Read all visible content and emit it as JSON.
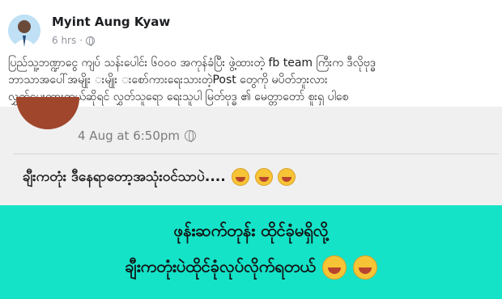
{
  "post": {
    "author": "Myint Aung Kyaw",
    "time": "6 hrs",
    "separator": "·",
    "audience_icon": "globe-icon",
    "caption_lines": [
      "ပြည်သူ့ဘဏ္ဍာငွေ ကျပ် သန်းပေါင်း ၆၀၀၀ အကုန်ခံပြီး ဖွဲ့ထားတဲ့ fb team ကြီးက ဒီလိုဗုဒ္ဓ",
      "ဘာသာအပေါ်အမျိုး းမျိုး းစော်ကားရေးသားတဲ့Post တွေကို မပိတ်ဘူးလား",
      "လွှတ်ပေးထားတယ်ဆိုရင် လွှတ်သူရော ရေးသူပါ မြတ်ဗုဒ္ဓ ၏ မေတ္တာတော် စူးရှ ပါစေ"
    ]
  },
  "shared_screenshot": {
    "timestamp": "4 Aug at 6:50pm",
    "comment_text": "ချီးကတုံး ဒီနေရာတော့အသုံးဝင်သာပဲ....",
    "emoji": "laughing-tears-emoji"
  },
  "banner": {
    "line1": "ဖုန်းဆက်တုန်း ထိုင်ခုံမရှိလို့",
    "line2": "ချီးကတုံးပဲထိုင်ခုံလုပ်လိုက်ရတယ်",
    "background_color": "#14e3c8"
  }
}
